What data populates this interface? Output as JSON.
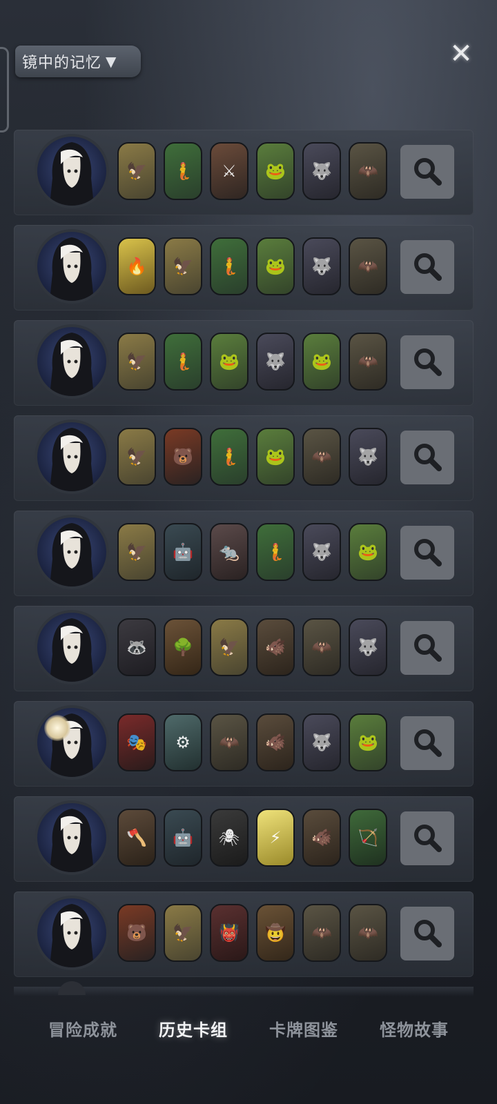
{
  "header": {
    "title": "镜中的记忆",
    "dropdown_icon": "triangle-down-icon",
    "close_icon": "close-icon"
  },
  "colors": {
    "card_yellow": "#e8d35a",
    "card_green": "#4f7a3e",
    "card_dark": "#3a3a45",
    "card_brown": "#6b5b45",
    "search_bg": "#6a6e75"
  },
  "rows": [
    {
      "cards": [
        "eagle",
        "siren",
        "knight",
        "frog",
        "wolf",
        "bat"
      ]
    },
    {
      "cards": [
        "fire-warrior",
        "eagle",
        "siren",
        "frog",
        "wolf",
        "bat"
      ]
    },
    {
      "cards": [
        "eagle",
        "siren",
        "frog",
        "wolf",
        "frog",
        "bat"
      ]
    },
    {
      "cards": [
        "eagle",
        "fire-bear",
        "siren",
        "frog",
        "bat",
        "wolf"
      ]
    },
    {
      "cards": [
        "eagle",
        "robot",
        "rat",
        "siren",
        "wolf",
        "frog"
      ]
    },
    {
      "cards": [
        "raccoon",
        "treant",
        "eagle",
        "toad-man",
        "bat",
        "wolf"
      ]
    },
    {
      "cards": [
        "jester",
        "machine",
        "bat",
        "toad-man",
        "wolf",
        "frog"
      ]
    },
    {
      "cards": [
        "dwarf",
        "robot",
        "spider",
        "lightning",
        "toad-man",
        "ranger"
      ]
    },
    {
      "cards": [
        "fire-bear",
        "eagle",
        "imp",
        "cowboy",
        "bat",
        "bat"
      ]
    }
  ],
  "tabs": [
    {
      "label": "冒险成就",
      "active": false
    },
    {
      "label": "历史卡组",
      "active": true
    },
    {
      "label": "卡牌图鉴",
      "active": false
    },
    {
      "label": "怪物故事",
      "active": false
    }
  ]
}
